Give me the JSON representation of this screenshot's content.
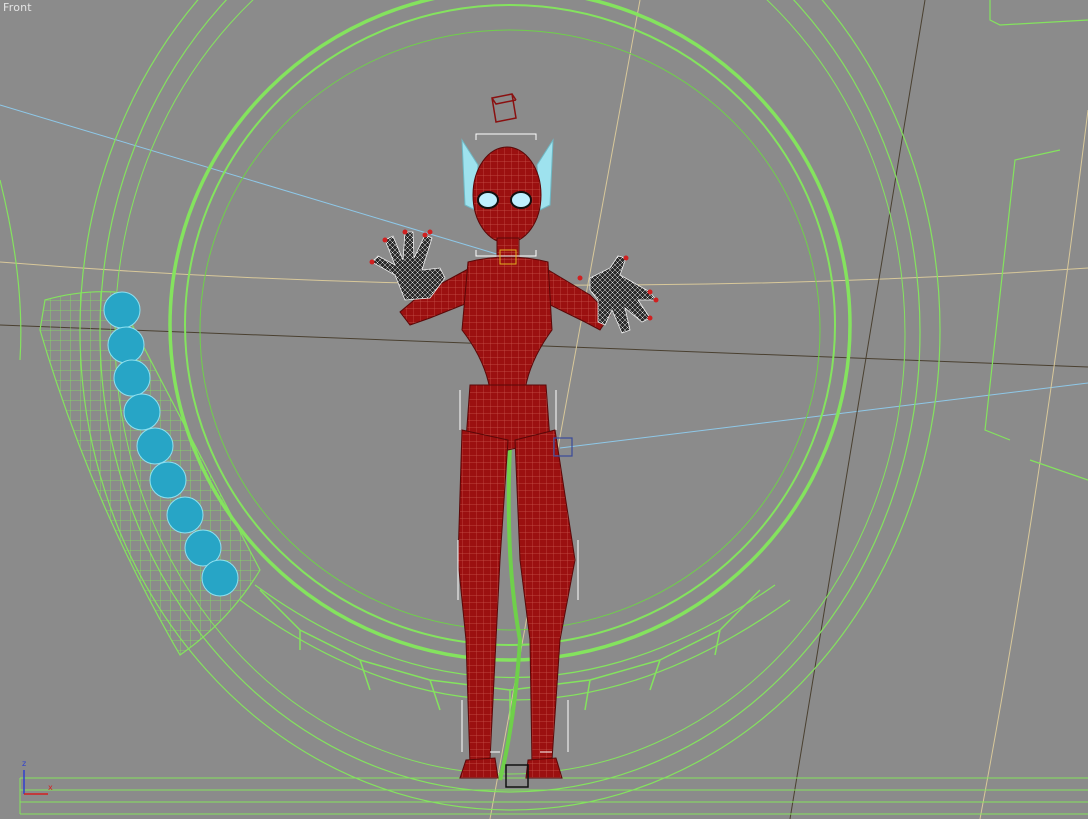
{
  "viewport": {
    "label": "Front",
    "background": "#8b8b8b"
  },
  "axis_gizmo": {
    "z_label": "z",
    "x_label": "x",
    "z_color": "#2f3fd0",
    "x_color": "#d42020"
  },
  "colors": {
    "ring_green": "#84e35e",
    "ring_green_dark": "#5ec23c",
    "mesh_red": "#9b1010",
    "mesh_line": "#c4504a",
    "bone_white": "#ffffff",
    "spheres_cyan": "#27a5c6",
    "ears_cyan": "#9ee2ee",
    "hands_dark": "#2a2a2a",
    "light_line_blue": "#8ec8e8",
    "light_line_tan": "#d8c89a",
    "dark_line": "#4a4030",
    "helper_dark_red": "#8a1010",
    "helper_blue": "#3a4a9a"
  }
}
